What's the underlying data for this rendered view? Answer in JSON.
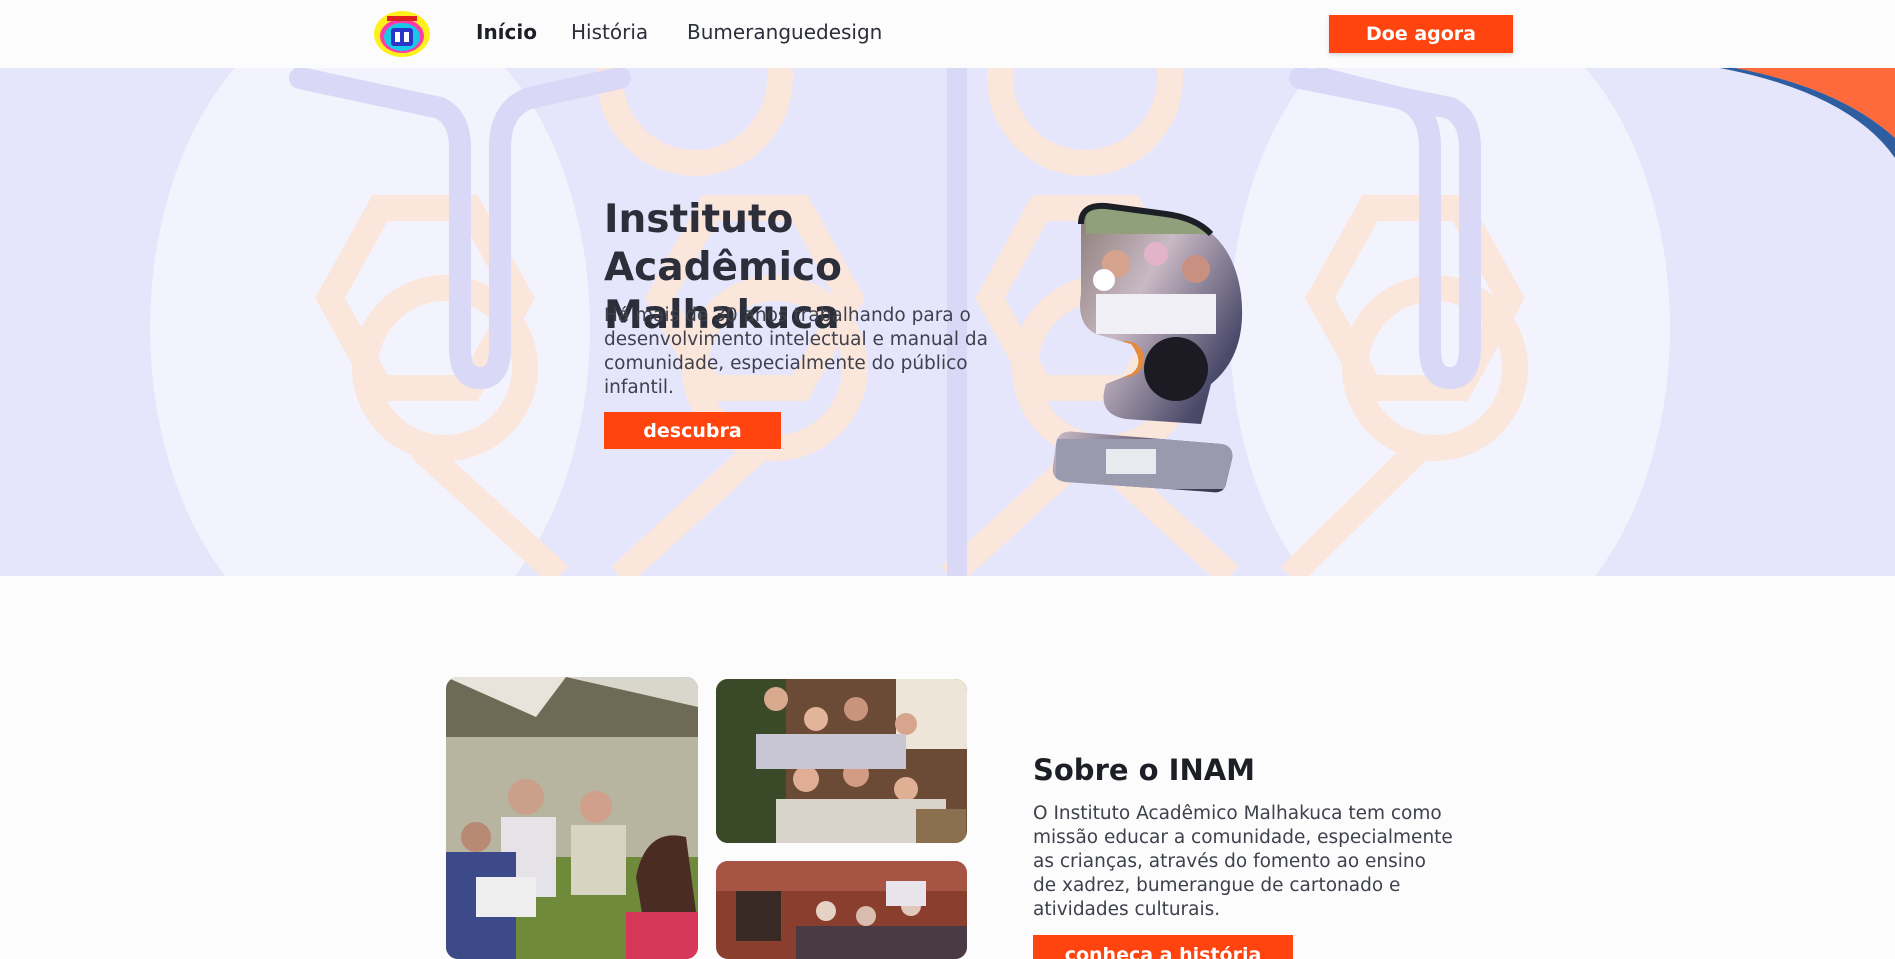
{
  "nav": {
    "logo_icon": "institute-crest-logo",
    "links": [
      {
        "label": "Início",
        "active": true
      },
      {
        "label": "História",
        "active": false
      },
      {
        "label": "Bumeranguedesign",
        "active": false
      }
    ],
    "donate_label": "Doe agora"
  },
  "hero": {
    "title": "Instituto Acadêmico Malhakuca",
    "text": "Há mais de 30 anos trabalhando para o desenvolvimento intelectual e manual da comunidade, especialmente do público infantil.",
    "button_label": "descubra"
  },
  "about": {
    "title": "Sobre o INAM",
    "text": "O Instituto Acadêmico Malhakuca tem como missão educar a comunidade, especialmente as crianças, através do fomento ao ensino de xadrez, bumerangue de cartonado e atividades culturais.",
    "button_label": "conheça a história"
  },
  "colors": {
    "accent": "#ff4410",
    "hero_background": "#e5e5fb",
    "text": "#2c2f3a"
  }
}
